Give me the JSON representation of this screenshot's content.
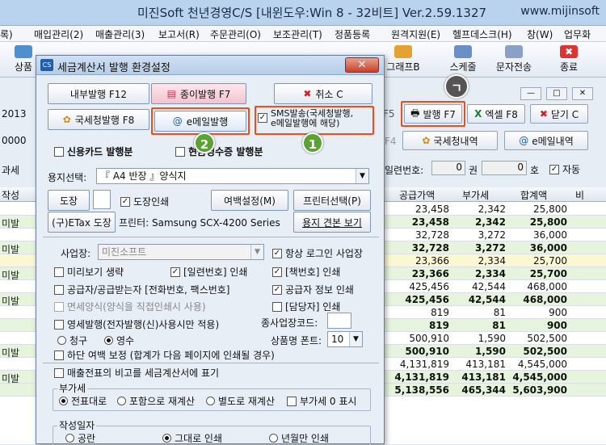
{
  "window": {
    "title": "미진Soft 천년경영C/S [내윈도우:Win 8 - 32비트] Ver.2.59.1327",
    "url": "www.mijinsoft"
  },
  "menu": [
    "록)",
    "매입관리(2)",
    "매출관리(3)",
    "보고서(R)",
    "주문관리(O)",
    "보조관리(T)",
    "정품등록",
    "원격지원(E)",
    "헬프데스크(H)",
    "창(W)",
    "업무화"
  ],
  "toolbar": {
    "left": "상품",
    "graph": "그래프B",
    "schedule": "스케줄",
    "sms": "문자전송",
    "exit": "종료"
  },
  "main": {
    "f5": "F5",
    "issue_btn": "발행 F7",
    "excel_btn": "엑셀 F8",
    "close_btn": "닫기 C",
    "f4": "F4",
    "nts_list_btn": "국세청내역",
    "email_list_btn": "e메일내역",
    "serial_label": "일련번호:",
    "serial_a": "0",
    "serial_b": "0",
    "kwon": "권",
    "ho": "호",
    "auto_label": "자동",
    "left_year": "2013",
    "left_code": "0000",
    "left_tax": "과세",
    "left_col": "작성",
    "grid_headers": [
      "공급가액",
      "부가세",
      "합계액",
      "비"
    ],
    "row_labels": [
      "미발",
      "미발",
      "미발",
      "미발",
      "미발",
      "미발"
    ],
    "rows": [
      [
        "23,458",
        "2,342",
        "25,800"
      ],
      [
        "23,458",
        "2,342",
        "25,800"
      ],
      [
        "32,728",
        "3,272",
        "36,000"
      ],
      [
        "32,728",
        "3,272",
        "36,000"
      ],
      [
        "23,366",
        "2,334",
        "25,700"
      ],
      [
        "23,366",
        "2,334",
        "25,700"
      ],
      [
        "425,456",
        "42,544",
        "468,000"
      ],
      [
        "425,456",
        "42,544",
        "468,000"
      ],
      [
        "819",
        "81",
        "900"
      ],
      [
        "819",
        "81",
        "900"
      ],
      [
        "500,910",
        "1,590",
        "502,500"
      ],
      [
        "500,910",
        "1,590",
        "502,500"
      ],
      [
        "4,131,819",
        "413,181",
        "4,545,000"
      ],
      [
        "4,131,819",
        "413,181",
        "4,545,000"
      ],
      [
        "5,138,556",
        "465,344",
        "5,603,900"
      ]
    ]
  },
  "dialog": {
    "title": "세금계산서 발행 환경설정",
    "icon_text": "CS",
    "internal_btn": "내부발행 F12",
    "paper_btn": "종이발행 F7",
    "cancel_btn": "취소 C",
    "nts_btn": "국세청발행 F8",
    "email_btn": "e메일발행",
    "sms_check": "SMS발송(국세청발행,\ne메일발행에 해당)",
    "credit_card": "신용카드 발행분",
    "cash_receipt": "현금영수증 발행분",
    "paper_label": "용지선택:",
    "paper_value": "『 A4 반장 』양식지",
    "seal_btn": "도장",
    "seal_print": "도장인쇄",
    "margin_btn": "여백설정(M)",
    "printer_btn": "프린터선택(P)",
    "etax_btn": "(구)ETax 도장",
    "printer_label": "프린터: Samsung SCX-4200 Series",
    "sample_btn": "용지 견본 보기",
    "biz_label": "사업장:",
    "biz_value": "미진소프트",
    "always_login": "항상 로그인 사업장",
    "skip_preview": "미리보기 생략",
    "serial_print": "[일련번호] 인쇄",
    "book_print": "[책번호] 인쇄",
    "supplier_print": "공급자/공급받는자 [전화번호, 팩스번호]",
    "supplier_info": "공급자 정보 인쇄",
    "tax_free": "면세양식(양식을 직접인쇄시 사용)",
    "manager_print": "[담당자] 인쇄",
    "zero_rate": "영세발행(전자발행(신)사용시만 적용)",
    "sub_biz_code": "종사업장코드:",
    "claim": "청구",
    "receipt": "영수",
    "item_font": "상품명 폰트:",
    "font_size": "10",
    "bottom_margin": "하단 여백 보정 (합계가 다음 페이지에 인쇄될 경우)",
    "memo_print": "매출전표의 비고를 세금계산서에 표기",
    "vat_group": "부가세",
    "vat_opt1": "전표대로",
    "vat_opt2": "포함으로 재계산",
    "vat_opt3": "별도로 재계산",
    "vat_zero": "부가세 0 표시",
    "date_group": "작성일자",
    "date_opt1": "공란",
    "date_opt2": "그대로 인쇄",
    "date_opt3": "년월만 인쇄"
  },
  "badges": {
    "b1": "1",
    "b2": "2",
    "b3": "ㄱ"
  },
  "colors": {
    "highlight": "#e8511d",
    "badge": "#5aa232",
    "total_green": "#e6f4dc",
    "total_yellow": "#fbf7d2"
  }
}
